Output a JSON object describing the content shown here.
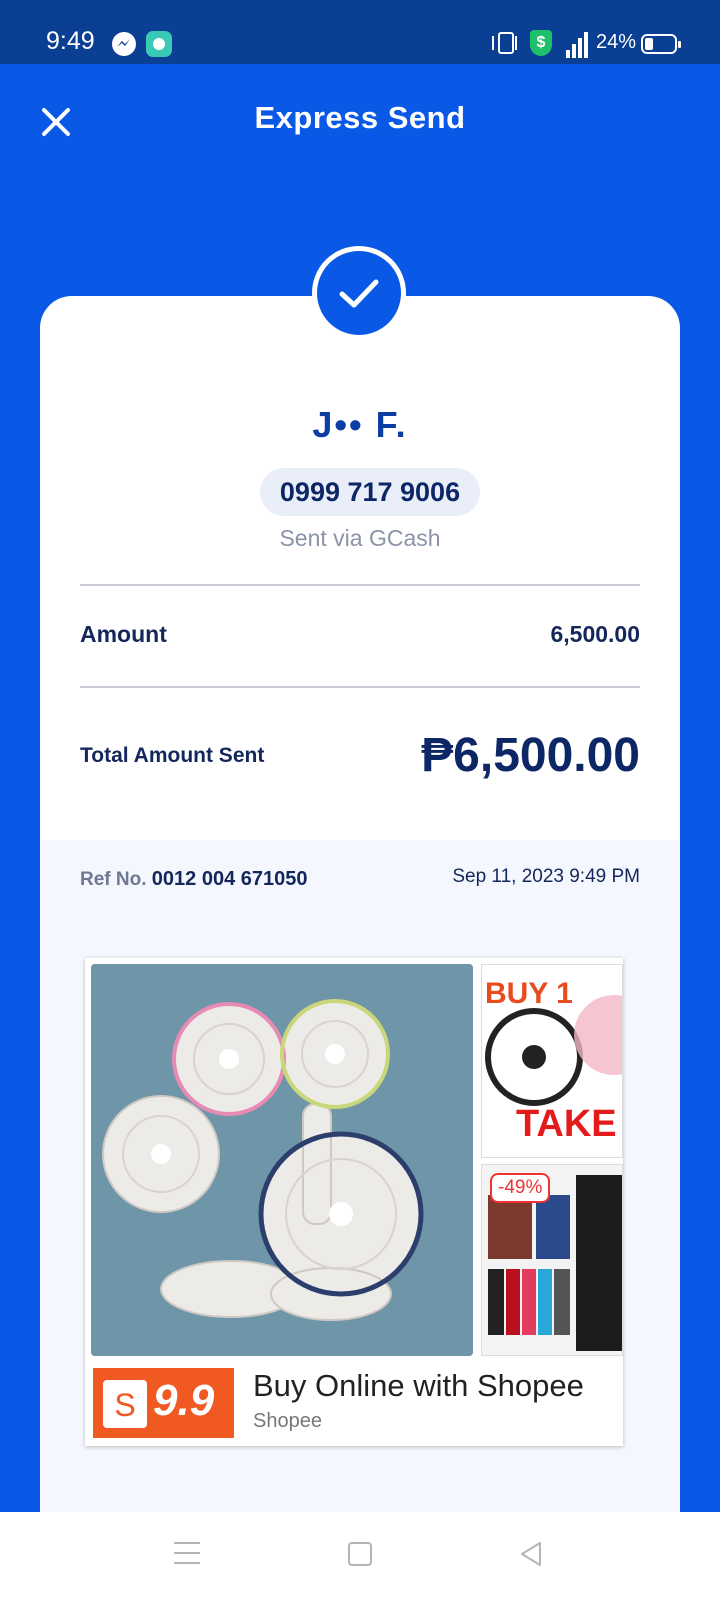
{
  "status_bar": {
    "time": "9:49",
    "battery": "24%",
    "network": "4G"
  },
  "header": {
    "title": "Express Send"
  },
  "receipt": {
    "recipient_name": "J•• F.",
    "phone": "0999 717 9006",
    "sent_via": "Sent via GCash",
    "amount_label": "Amount",
    "amount_value": "6,500.00",
    "total_label": "Total Amount Sent",
    "total_value": "₱6,500.00",
    "ref_label": "Ref No.",
    "ref_number": "0012 004 671050",
    "date": "Sep 11, 2023 9:49 PM"
  },
  "ad": {
    "title": "Buy Online with Shopee",
    "advertiser": "Shopee",
    "logo_text": "9.9",
    "side_text_1": "BUY 1",
    "side_text_2": "TAKE",
    "discount": "-49%"
  },
  "colors": {
    "primary": "#0a59e6",
    "status_bar": "#0a3f93",
    "navy_text": "#0d2766",
    "shopee_orange": "#f05a22"
  }
}
